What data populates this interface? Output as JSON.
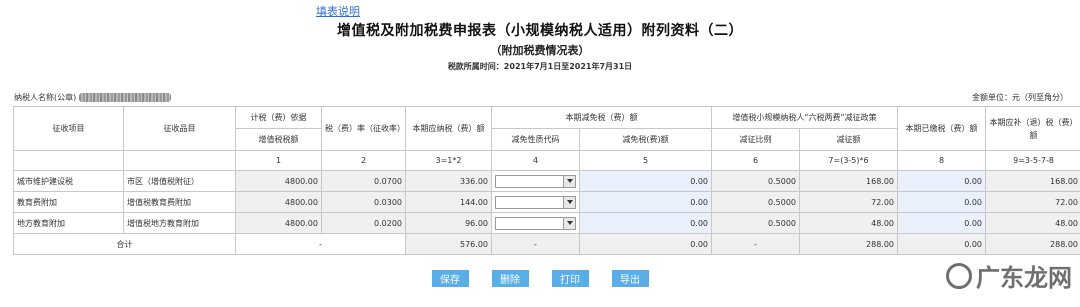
{
  "help_link": "填表说明",
  "title": "增值税及附加税费申报表（小规模纳税人适用）附列资料（二）",
  "subtitle": "（附加税费情况表）",
  "period": "税款所属时间：2021年7月1日至2021年7月31日",
  "taxpayer_label": "纳税人名称(公章)",
  "unit": "金额单位：元（列至角分）",
  "headers": {
    "item": "征收项目",
    "subitem": "征收品目",
    "basis": "计税（费）依据",
    "basis_sub": "增值税税额",
    "rate": "税（费）率（征收率）",
    "payable": "本期应纳税（费）额",
    "relief": "本期减免税（费）额",
    "relief_code": "减免性质代码",
    "relief_amount": "减免税(费)额",
    "policy": "增值税小规模纳税人“六税两费”减征政策",
    "policy_ratio": "减征比例",
    "policy_amount": "减征额",
    "paid": "本期已缴税（费）额",
    "refund": "本期应补（退）税（费）额"
  },
  "col_numbers": [
    "1",
    "2",
    "3=1*2",
    "4",
    "5",
    "6",
    "7=(3-5)*6",
    "8",
    "9=3-5-7-8"
  ],
  "rows": [
    {
      "item": "城市维护建设税",
      "subitem": "市区（增值税附征）",
      "basis": "4800.00",
      "rate": "0.0700",
      "payable": "336.00",
      "relief_code": "",
      "relief_amount": "0.00",
      "ratio": "0.5000",
      "reduction": "168.00",
      "paid": "0.00",
      "refund": "168.00"
    },
    {
      "item": "教育费附加",
      "subitem": "增值税教育费附加",
      "basis": "4800.00",
      "rate": "0.0300",
      "payable": "144.00",
      "relief_code": "",
      "relief_amount": "0.00",
      "ratio": "0.5000",
      "reduction": "72.00",
      "paid": "0.00",
      "refund": "72.00"
    },
    {
      "item": "地方教育附加",
      "subitem": "增值税地方教育附加",
      "basis": "4800.00",
      "rate": "0.0200",
      "payable": "96.00",
      "relief_code": "",
      "relief_amount": "0.00",
      "ratio": "0.5000",
      "reduction": "48.00",
      "paid": "0.00",
      "refund": "48.00"
    }
  ],
  "total": {
    "label": "合计",
    "basis": "-",
    "payable": "576.00",
    "relief_code": "-",
    "relief_amount": "0.00",
    "ratio": "-",
    "reduction": "288.00",
    "paid": "0.00",
    "refund": "288.00"
  },
  "buttons": {
    "save": "保存",
    "delete": "删除",
    "print": "打印",
    "export": "导出"
  },
  "watermark": "广东龙网"
}
